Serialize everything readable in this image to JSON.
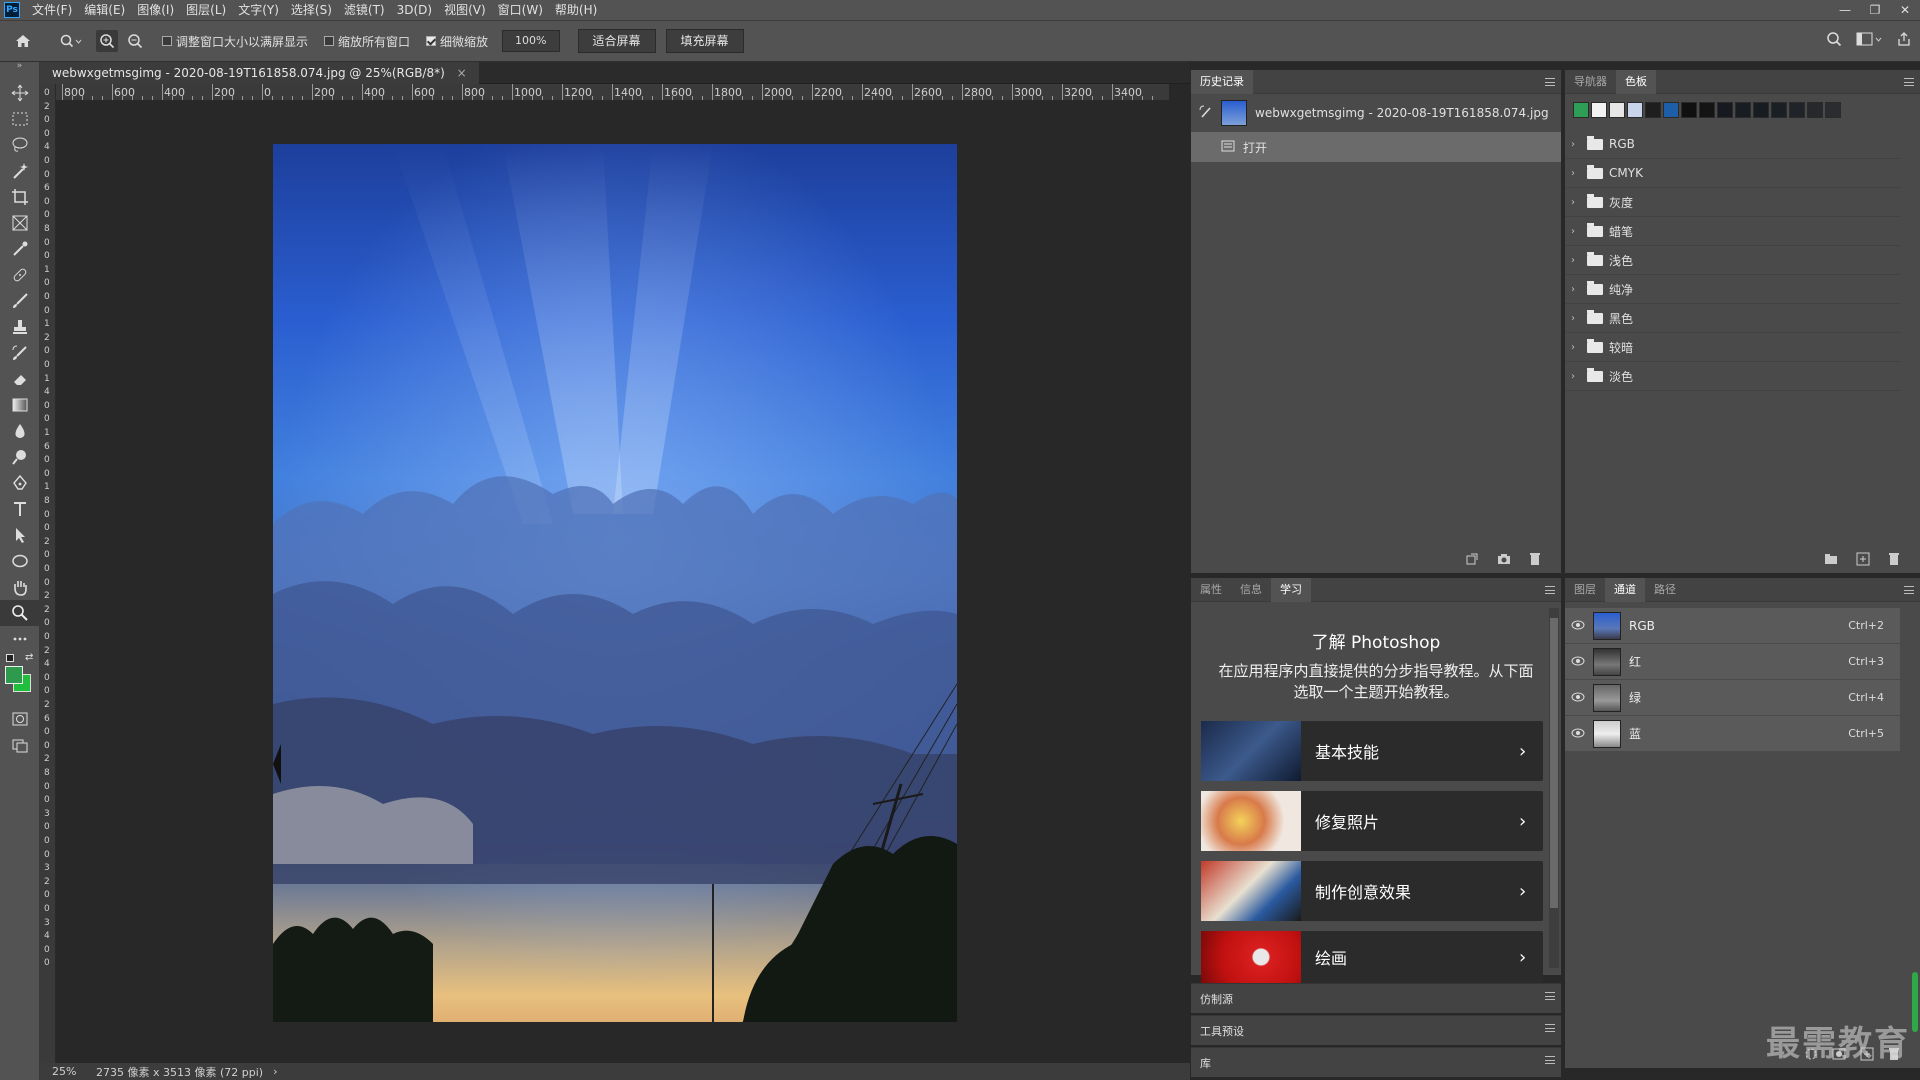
{
  "app": {
    "logo": "Ps",
    "menu": [
      "文件(F)",
      "编辑(E)",
      "图像(I)",
      "图层(L)",
      "文字(Y)",
      "选择(S)",
      "滤镜(T)",
      "3D(D)",
      "视图(V)",
      "窗口(W)",
      "帮助(H)"
    ]
  },
  "options": {
    "resize_windows": "调整窗口大小以满屏显示",
    "zoom_all": "缩放所有窗口",
    "scrubby_zoom": "细微缩放",
    "zoom_value": "100%",
    "fit_screen": "适合屏幕",
    "fill_screen": "填充屏幕",
    "checks": {
      "resize_windows": false,
      "zoom_all": false,
      "scrubby_zoom": true
    }
  },
  "document": {
    "tab_title": "webwxgetmsgimg - 2020-08-19T161858.074.jpg @ 25%(RGB/8*)",
    "ruler_labels": [
      "800",
      "600",
      "400",
      "200",
      "0",
      "200",
      "400",
      "600",
      "800",
      "1000",
      "1200",
      "1400",
      "1600",
      "1800",
      "2000",
      "2200",
      "2400",
      "2600",
      "2800",
      "3000",
      "3200",
      "3400"
    ],
    "vruler_labels": [
      "0",
      "2",
      "0",
      "0",
      "4",
      "0",
      "0",
      "6",
      "0",
      "0",
      "8",
      "0",
      "0",
      "1",
      "0",
      "0",
      "0",
      "1",
      "2",
      "0",
      "0",
      "1",
      "4",
      "0",
      "0",
      "1",
      "6",
      "0",
      "0",
      "1",
      "8",
      "0",
      "0",
      "2",
      "0",
      "0",
      "0",
      "2",
      "2",
      "0",
      "0",
      "2",
      "4",
      "0",
      "0",
      "2",
      "6",
      "0",
      "0",
      "2",
      "8",
      "0",
      "0",
      "3",
      "0",
      "0",
      "0",
      "3",
      "2",
      "0",
      "0",
      "3",
      "4",
      "0",
      "0"
    ],
    "zoom": "25%",
    "info": "2735 像素 x 3513 像素 (72 ppi)"
  },
  "history": {
    "tab": "历史记录",
    "snapshot": "webwxgetmsgimg - 2020-08-19T161858.074.jpg",
    "steps": [
      "打开"
    ]
  },
  "swatches": {
    "tabs": [
      "导航器",
      "色板"
    ],
    "active_tab": "色板",
    "colors": [
      "#2e9e57",
      "#f2f2f2",
      "#e6e6e6",
      "#c9d5ea",
      "#1e1e1e",
      "#1d5ea8",
      "#101010",
      "#141414",
      "#161a20",
      "#181d24",
      "#161c22",
      "#1a1f25",
      "#20232a",
      "#26282c",
      "#2a2c30"
    ],
    "folders": [
      "RGB",
      "CMYK",
      "灰度",
      "蜡笔",
      "浅色",
      "纯净",
      "黑色",
      "较暗",
      "淡色"
    ]
  },
  "learn": {
    "tabs": [
      "属性",
      "信息",
      "学习"
    ],
    "active_tab": "学习",
    "heading": "了解 Photoshop",
    "description": "在应用程序内直接提供的分步指导教程。从下面选取一个主题开始教程。",
    "cards": [
      "基本技能",
      "修复照片",
      "制作创意效果",
      "绘画"
    ]
  },
  "collapsed_panels": [
    "仿制源",
    "工具预设",
    "库"
  ],
  "channels": {
    "tabs": [
      "图层",
      "通道",
      "路径"
    ],
    "active_tab": "通道",
    "rows": [
      {
        "name": "RGB",
        "shortcut": "Ctrl+2"
      },
      {
        "name": "红",
        "shortcut": "Ctrl+3"
      },
      {
        "name": "绿",
        "shortcut": "Ctrl+4"
      },
      {
        "name": "蓝",
        "shortcut": "Ctrl+5"
      }
    ]
  },
  "colors": {
    "foreground": "#2f9a4e",
    "background": "#1fbf3b"
  },
  "watermark": "最需教育"
}
